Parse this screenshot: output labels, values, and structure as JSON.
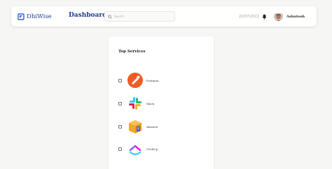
{
  "header": {
    "brand_name": "DhiWise",
    "page_title": "Dashboard",
    "search_placeholder": "Search",
    "date": "22/07/2022",
    "username": "Ashutosh"
  },
  "icons": {
    "logo": "dhiwise-logo-icon",
    "search": "search-icon",
    "bell": "bell-icon",
    "avatar": "user-avatar"
  },
  "services": {
    "title": "Top Services",
    "items": [
      {
        "name": "Postman",
        "icon": "postman-icon",
        "color": "#ef5b25"
      },
      {
        "name": "Slack",
        "icon": "slack-icon",
        "color": "#e01e5a"
      },
      {
        "name": "Amazon",
        "icon": "amazon-box-icon",
        "color": "#f5a623"
      },
      {
        "name": "ClickUp",
        "icon": "clickup-icon",
        "color": "#7b68ee"
      }
    ]
  },
  "colors": {
    "brand": "#1d3b8c",
    "background": "#f6f6f4"
  }
}
